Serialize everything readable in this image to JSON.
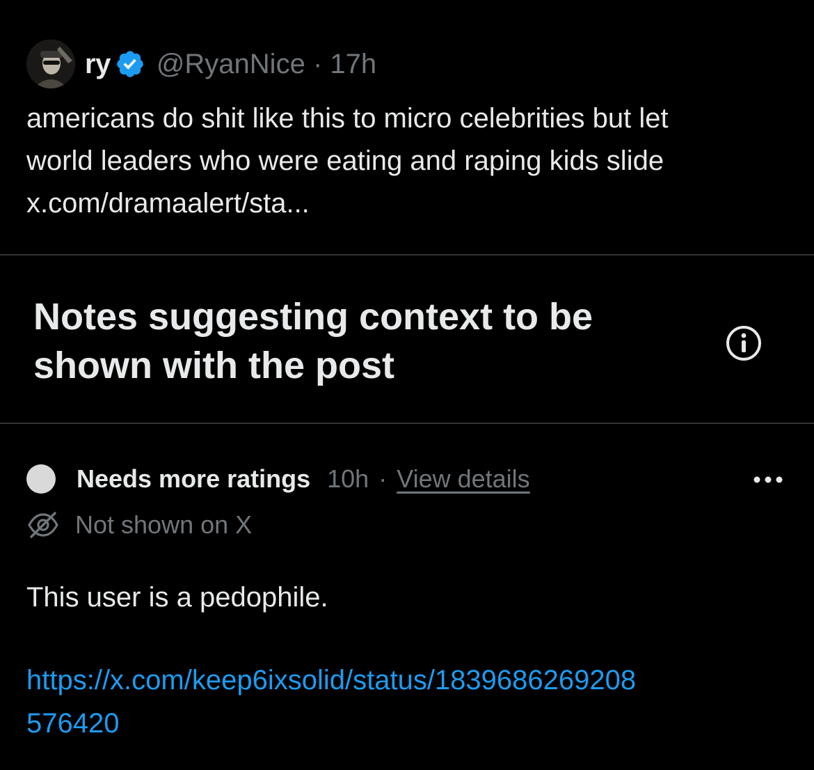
{
  "post": {
    "display_name": "ry",
    "handle": "@RyanNice",
    "separator": "·",
    "time": "17h",
    "text_lines": [
      "americans do shit like this to micro celebrities but let",
      "world leaders who were eating and raping kids slide",
      "x.com/dramaalert/sta..."
    ],
    "avatar_icon": "avatar",
    "verified_icon": "verified-badge-icon",
    "verified_color": "#1d9bf0"
  },
  "notes_section": {
    "title_lines": [
      "Notes suggesting context to be",
      "shown with the post"
    ],
    "info_icon": "info-icon"
  },
  "note": {
    "status": "Needs more ratings",
    "time": "10h",
    "separator": "·",
    "view_details": "View details",
    "not_shown": "Not shown on X",
    "text": "This user is a pedophile.",
    "link_lines": [
      "https://x.com/keep6ixsolid/status/1839686269208",
      "576420"
    ],
    "link_color": "#1d9bf0",
    "status_dot_color": "#d9d9d9",
    "more_icon": "more-options-icon",
    "not_shown_icon": "eye-off-icon"
  },
  "colors": {
    "background": "#000000",
    "text_primary": "#e7e9ea",
    "text_secondary": "#71767b",
    "divider": "#2f3336"
  }
}
